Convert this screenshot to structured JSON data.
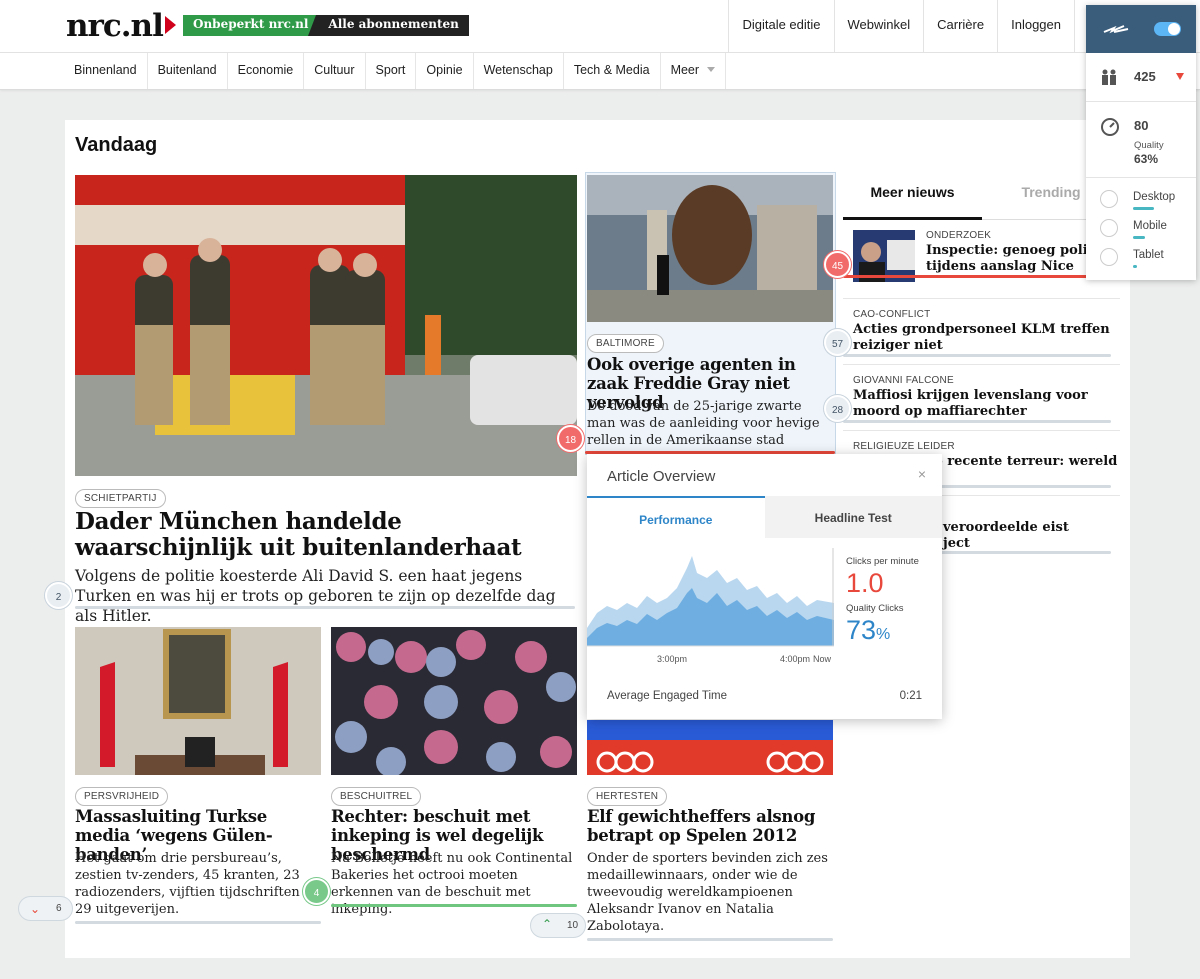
{
  "header": {
    "logo": "nrc.nl",
    "subscribe_green": "Onbeperkt nrc.nl",
    "subscribe_black": "Alle abonnementen",
    "links": [
      "Digitale editie",
      "Webwinkel",
      "Carrière",
      "Inloggen"
    ]
  },
  "nav": [
    "Binnenland",
    "Buitenland",
    "Economie",
    "Cultuur",
    "Sport",
    "Opinie",
    "Wetenschap",
    "Tech & Media",
    "Meer"
  ],
  "section_title": "Vandaag",
  "lead": {
    "tag": "SCHIETPARTIJ",
    "title": "Dader München handelde waarschijnlijk uit buitenlanderhaat",
    "summary": "Volgens de politie koesterde Ali David S. een haat jegens Turken en was hij er trots op geboren te zijn op dezelfde dag als Hitler.",
    "badge": "2"
  },
  "second": {
    "tag": "BALTIMORE",
    "title": "Ook overige agenten in zaak Freddie Gray niet vervolgd",
    "summary": "De dood van de 25-jarige zwarte man was de aanleiding voor hevige rellen in de Amerikaanse stad Baltimore.",
    "badge_top": "57",
    "badge_red": "18"
  },
  "cards": [
    {
      "tag": "PERSVRIJHEID",
      "title": "Massasluiting Turkse media ‘wegens Gülen-banden’",
      "summary": "Het gaat om drie persbureau’s, zestien tv-zenders, 45 kranten, 23 radiozenders, vijftien tijdschriften en 29 uitgeverijen."
    },
    {
      "tag": "BESCHUITREL",
      "title": "Rechter: beschuit met inkeping is wel degelijk beschermd",
      "summary": "Na Bolletje heeft nu ook Continental Bakeries het octrooi moeten erkennen van de beschuit met inkeping.",
      "badge": "4"
    },
    {
      "tag": "HERTESTEN",
      "title": "Elf gewichtheffers alsnog betrapt op Spelen 2012",
      "summary": "Onder de sporters bevinden zich zes medaillewinnaars, onder wie de tweevoudig wereldkampioenen Aleksandr Ivanov en Natalia Zabolotaya."
    }
  ],
  "sidebar": {
    "tab_active": "Meer nieuws",
    "tab_inactive": "Trending",
    "items": [
      {
        "category": "ONDERZOEK",
        "title": "Inspectie: genoeg politie tijdens aanslag Nice",
        "badge": "45"
      },
      {
        "category": "CAO-CONFLICT",
        "title": "Acties grondpersoneel KLM treffen reiziger niet",
        "badge": "57"
      },
      {
        "category": "GIOVANNI FALCONE",
        "title": "Maffiosi krijgen levenslang voor moord op maffiarechter",
        "badge": "28"
      },
      {
        "category": "RELIGIEUZE LEIDER",
        "title": "op recente terreur: wereld is"
      },
      {
        "category": "",
        "title": "veroordeelde eist",
        "title2": "ject"
      }
    ]
  },
  "overview": {
    "title": "Article Overview",
    "close": "×",
    "tab_active": "Performance",
    "tab_inactive": "Headline Test",
    "clicks_label": "Clicks per minute",
    "clicks_value": "1.0",
    "quality_label": "Quality Clicks",
    "quality_value": "73",
    "quality_unit": "%",
    "x_ticks": [
      "3:00pm",
      "4:00pm",
      "Now"
    ],
    "engaged_label": "Average Engaged Time",
    "engaged_value": "0:21",
    "colors": {
      "accent": "#2e86c9",
      "red": "#e8483b",
      "area_light": "#b8d6ef",
      "area_dark": "#6faee0"
    }
  },
  "widget": {
    "visitors": "425",
    "quality_score": "80",
    "quality_label": "Quality",
    "quality_pct": "63%",
    "devices": [
      {
        "label": "Desktop",
        "share": 0.9
      },
      {
        "label": "Mobile",
        "share": 0.5
      },
      {
        "label": "Tablet",
        "share": 0.15
      }
    ]
  },
  "bottom": {
    "left_count": "6",
    "right_count": "10"
  }
}
